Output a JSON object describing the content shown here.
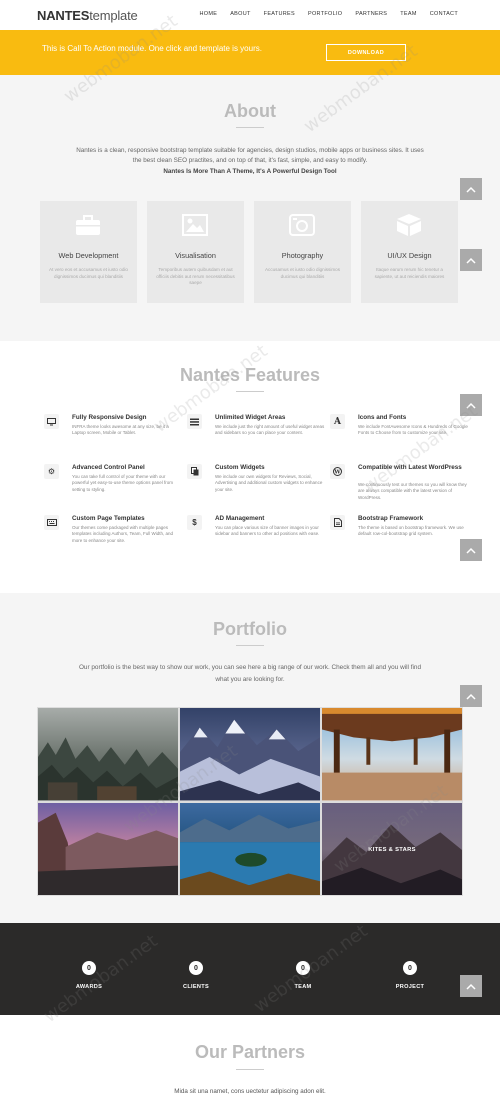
{
  "brand": {
    "bold": "NANTES",
    "light": "template"
  },
  "nav": [
    "HOME",
    "ABOUT",
    "FEATURES",
    "PORTFOLIO",
    "PARTNERS",
    "TEAM",
    "CONTACT"
  ],
  "cta": {
    "text": "This is Call To Action module. One click and template is yours.",
    "button": "DOWNLOAD"
  },
  "about": {
    "title": "About",
    "desc": "Nantes is a clean, responsive bootstrap template suitable for agencies, design studios, mobile apps or business sites. It uses the best clean SEO practites, and on top of that, it's fast, simple, and easy to modify.",
    "strong": "Nantes Is More Than A Theme, It's A Powerful Design Tool",
    "cards": [
      {
        "title": "Web Development",
        "desc": "At vero eos et accusamus et iusto odio dignissimos ducimus qui blanditiis",
        "icon": "briefcase-icon"
      },
      {
        "title": "Visualisation",
        "desc": "Temporibus autem quibusdam et aut officiis debitis aut rerum necessitatibus saepe",
        "icon": "image-icon"
      },
      {
        "title": "Photography",
        "desc": "Accusamus et iusto odio dignissimos ducimus qui blanditiis",
        "icon": "camera-icon"
      },
      {
        "title": "UI/UX Design",
        "desc": "Itaque earum rerum hic tenetur a sapiente, ut aut reiciendis maiores",
        "icon": "cube-icon"
      }
    ]
  },
  "features": {
    "title": "Nantes Features",
    "items": [
      {
        "title": "Fully Responsive Design",
        "desc": "INFRA theme looks awesome at any size, be it a Laptop screen, Mobile or Tablet.",
        "icon": "monitor-icon"
      },
      {
        "title": "Unlimited Widget Areas",
        "desc": "We include just the right amount of useful widget areas and sidebars so you can place your content.",
        "icon": "list-icon"
      },
      {
        "title": "Icons and Fonts",
        "desc": "We include FontAwesome Icons & Hundreds of Google Fonts to Choose from to customize your site.",
        "icon": "font-icon"
      },
      {
        "title": "Advanced Control Panel",
        "desc": "You can take full control of your theme with our powerful yet easy-to-use theme options panel from setting to styling.",
        "icon": "cogs-icon"
      },
      {
        "title": "Custom Widgets",
        "desc": "We include our own widgets for Reviews, Social, Advertising and additional custom widgets to enhance your site.",
        "icon": "copy-icon"
      },
      {
        "title": "Compatible with Latest WordPress",
        "desc": "We continuously test our themes so you will know they are always compatible with the latest version of WordPress.",
        "icon": "wordpress-icon"
      },
      {
        "title": "Custom Page Templates",
        "desc": "Our themes come packaged with multiple pages templates including Authors, Team, Full Width, and more to enhance your site.",
        "icon": "keyboard-icon"
      },
      {
        "title": "AD Management",
        "desc": "You can place various size of banner images in your sidebar and banners to other ad positions with ease.",
        "icon": "dollar-icon"
      },
      {
        "title": "Bootstrap Framework",
        "desc": "The theme is based on bootstrap framework. We use default row-col-bootstrap grid system.",
        "icon": "file-icon"
      }
    ]
  },
  "portfolio": {
    "title": "Portfolio",
    "desc": "Our portfolio is the best way to show our work, you can see here a big range of our work. Check them all and you will find what you are looking for.",
    "hover_label": "KITES & STARS"
  },
  "stats": [
    {
      "value": "0",
      "label": "AWARDS"
    },
    {
      "value": "0",
      "label": "CLIENTS"
    },
    {
      "value": "0",
      "label": "TEAM"
    },
    {
      "value": "0",
      "label": "PROJECT"
    }
  ],
  "partners": {
    "title": "Our Partners",
    "desc": "Mida sit una namet, cons uectetur adipiscing adon elit."
  },
  "watermark": "webmoban.net",
  "colors": {
    "accent": "#f9bb10",
    "dark": "#2b2a29",
    "panel": "#f5f5f5",
    "scroll_button": "#aaaaaa"
  }
}
